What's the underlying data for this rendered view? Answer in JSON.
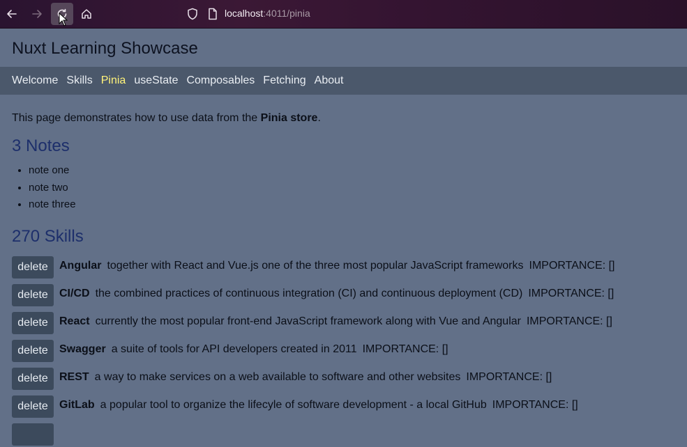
{
  "browser": {
    "url_host": "localhost",
    "url_rest": ":4011/pinia"
  },
  "site": {
    "title": "Nuxt Learning Showcase",
    "nav": [
      {
        "label": "Welcome"
      },
      {
        "label": "Skills"
      },
      {
        "label": "Pinia"
      },
      {
        "label": "useState"
      },
      {
        "label": "Composables"
      },
      {
        "label": "Fetching"
      },
      {
        "label": "About"
      }
    ]
  },
  "intro": {
    "prefix": "This page demonstrates how to use data from the ",
    "bold": "Pinia store",
    "suffix": "."
  },
  "notes": {
    "heading": "3 Notes",
    "items": [
      "note one",
      "note two",
      "note three"
    ]
  },
  "skills": {
    "heading": "270 Skills",
    "delete_label": "delete",
    "items": [
      {
        "name": "Angular",
        "description": "together with React and Vue.js one of the three most popular JavaScript frameworks",
        "importance": "IMPORTANCE: []"
      },
      {
        "name": "CI/CD",
        "description": "the combined practices of continuous integration (CI) and continuous deployment (CD)",
        "importance": "IMPORTANCE: []"
      },
      {
        "name": "React",
        "description": "currently the most popular front-end JavaScript framework along with Vue and Angular",
        "importance": "IMPORTANCE: []"
      },
      {
        "name": "Swagger",
        "description": "a suite of tools for API developers created in 2011",
        "importance": "IMPORTANCE: []"
      },
      {
        "name": "REST",
        "description": "a way to make services on a web available to software and other websites",
        "importance": "IMPORTANCE: []"
      },
      {
        "name": "GitLab",
        "description": "a popular tool to organize the lifecyle of software development - a local GitHub",
        "importance": "IMPORTANCE: []"
      }
    ]
  },
  "colors": {
    "page_bg": "#627088",
    "nav_bg": "#4b586b",
    "active_nav": "#fff37a",
    "heading": "#1d2f6b",
    "button_bg": "#3c4a5c"
  }
}
